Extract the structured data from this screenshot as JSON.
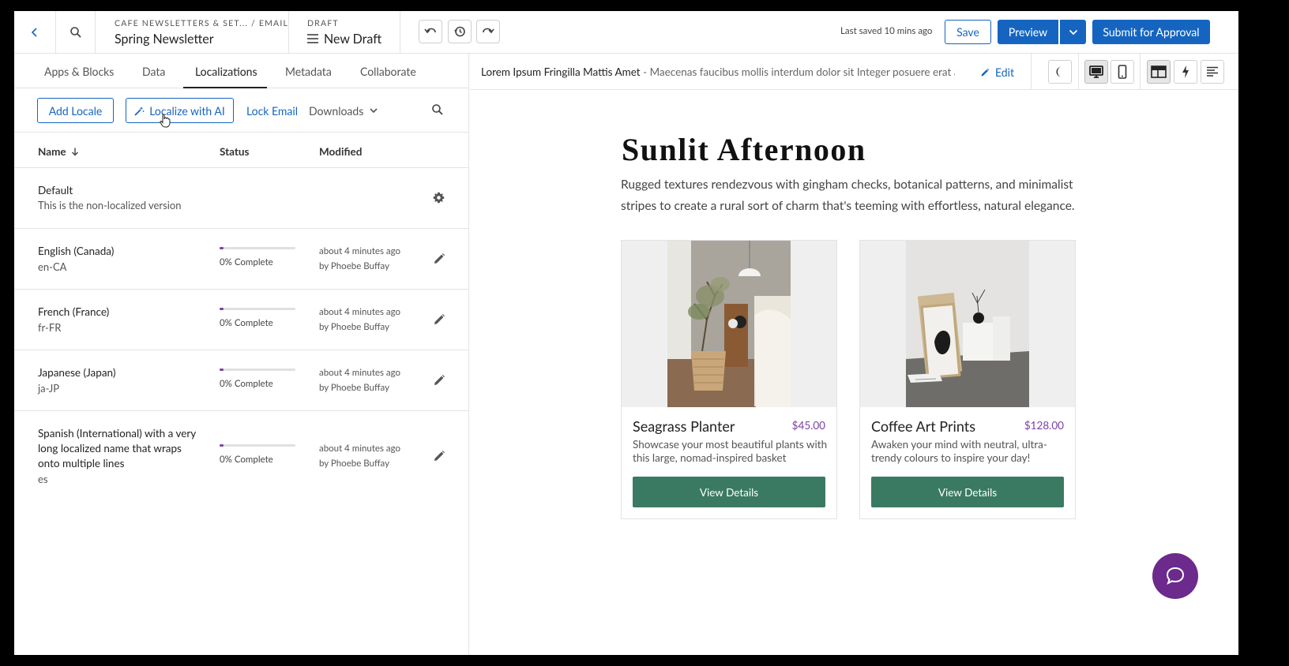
{
  "header": {
    "breadcrumb_path": "CAFE NEWSLETTERS & SET... / EMAIL",
    "email_name": "Spring Newsletter",
    "draft_label": "DRAFT",
    "draft_name": "New Draft",
    "last_saved": "Last saved 10 mins ago",
    "save_label": "Save",
    "preview_label": "Preview",
    "submit_label": "Submit for Approval"
  },
  "tabs": [
    {
      "label": "Apps & Blocks"
    },
    {
      "label": "Data"
    },
    {
      "label": "Localizations"
    },
    {
      "label": "Metadata"
    },
    {
      "label": "Collaborate"
    }
  ],
  "active_tab": "Localizations",
  "toolbar": {
    "add_locale": "Add Locale",
    "localize_ai": "Localize with AI",
    "lock_email": "Lock Email",
    "downloads": "Downloads"
  },
  "table": {
    "col_name": "Name",
    "col_status": "Status",
    "col_modified": "Modified",
    "default_row": {
      "name": "Default",
      "subtitle": "This is the non-localized version"
    },
    "rows": [
      {
        "name": "English (Canada)",
        "code": "en-CA",
        "progress": 0.05,
        "status": "0% Complete",
        "modified": "about 4 minutes ago",
        "by": "by Phoebe Buffay"
      },
      {
        "name": "French (France)",
        "code": "fr-FR",
        "progress": 0.05,
        "status": "0% Complete",
        "modified": "about 4 minutes ago",
        "by": "by Phoebe Buffay"
      },
      {
        "name": "Japanese (Japan)",
        "code": "ja-JP",
        "progress": 0.05,
        "status": "0% Complete",
        "modified": "about 4 minutes ago",
        "by": "by Phoebe Buffay"
      },
      {
        "name": "Spanish (International) with a very long localized name that wraps onto multiple lines",
        "code": "es",
        "progress": 0.05,
        "status": "0% Complete",
        "modified": "about 4 minutes ago",
        "by": "by Phoebe Buffay"
      }
    ]
  },
  "preview": {
    "subject": "Lorem Ipsum Fringilla Mattis Amet",
    "preheader": "- Maecenas faucibus mollis interdum dolor sit Integer posuere erat a...",
    "edit_label": "Edit",
    "heading": "Sunlit Afternoon",
    "intro": "Rugged textures rendezvous with gingham checks, botanical patterns, and minimalist stripes to create a rural sort of charm that's teeming with effortless, natural elegance.",
    "products": [
      {
        "title": "Seagrass Planter",
        "price": "$45.00",
        "desc": "Showcase your most beautiful plants with this large, nomad-inspired basket",
        "button": "View Details"
      },
      {
        "title": "Coffee Art Prints",
        "price": "$128.00",
        "desc": "Awaken your mind with neutral, ultra-trendy colours to inspire your day!",
        "button": "View Details"
      }
    ]
  },
  "colors": {
    "brand_blue": "#1565c0",
    "progress_purple": "#7b3fa4",
    "button_green": "#3a7a62",
    "chat_purple": "#6b2a8c"
  }
}
